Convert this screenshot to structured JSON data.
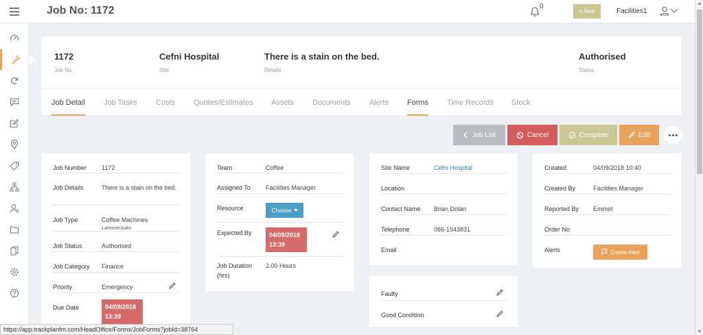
{
  "header": {
    "title": "Job No: 1172",
    "notification_count": "0",
    "new_label": "+ New",
    "user_name": "Facilities1"
  },
  "sidebar": {
    "items": [
      {
        "icon": "speedometer-icon"
      },
      {
        "icon": "wrench-icon",
        "active": true
      },
      {
        "icon": "refresh-icon"
      },
      {
        "icon": "chat-icon"
      },
      {
        "icon": "edit-icon"
      },
      {
        "icon": "location-icon"
      },
      {
        "icon": "tag-icon"
      },
      {
        "icon": "hierarchy-icon"
      },
      {
        "icon": "user-search-icon"
      },
      {
        "icon": "folder-icon"
      },
      {
        "icon": "documents-icon"
      },
      {
        "icon": "gear-icon"
      },
      {
        "icon": "help-icon"
      }
    ]
  },
  "summary": {
    "job_no": {
      "value": "1172",
      "label": "Job No."
    },
    "site": {
      "value": "Cefni Hospital",
      "label": "Site"
    },
    "details": {
      "value": "There is a stain on the bed.",
      "label": "Details"
    },
    "status": {
      "value": "Authorised",
      "label": "Status"
    }
  },
  "tabs": [
    {
      "label": "Job Detail",
      "active": true
    },
    {
      "label": "Job Tasks"
    },
    {
      "label": "Costs"
    },
    {
      "label": "Quotes/Estimates"
    },
    {
      "label": "Assets"
    },
    {
      "label": "Documents"
    },
    {
      "label": "Alerts"
    },
    {
      "label": "Forms",
      "active": true
    },
    {
      "label": "Time Records"
    },
    {
      "label": "Stock"
    }
  ],
  "actions": {
    "job_list": "Job List",
    "cancel": "Cancel",
    "complete": "Complete",
    "edit": "Edit"
  },
  "colors": {
    "accent": "#e7a35c",
    "cancel": "#d45c5c",
    "complete": "#cbc795",
    "job_list": "#b9bcc1",
    "date": "#d46a6a",
    "choose": "#4a9ec8"
  },
  "card1": {
    "job_number": {
      "label": "Job Number",
      "value": "1172"
    },
    "job_details": {
      "label": "Job Details",
      "value": "There is a stain on the bed."
    },
    "job_type": {
      "label": "Job Type",
      "value": "Coffee Machines",
      "sub": "Lammerzuko"
    },
    "job_status": {
      "label": "Job Status",
      "value": "Authorised"
    },
    "job_category": {
      "label": "Job Category",
      "value": "Finance"
    },
    "priority": {
      "label": "Priority",
      "value": "Emergency"
    },
    "due_date": {
      "label": "Due Date",
      "date": "04/09/2018",
      "time": "13:39"
    }
  },
  "card2": {
    "team": {
      "label": "Team",
      "value": "Coffee"
    },
    "assigned_to": {
      "label": "Assigned To",
      "value": "Facilities Manager"
    },
    "resource": {
      "label": "Resource",
      "button": "Choose"
    },
    "expected_by": {
      "label": "Expected By",
      "date": "04/09/2018",
      "time": "13:39"
    },
    "job_duration": {
      "label": "Job Duration (hrs)",
      "value": "2.00 Hours"
    }
  },
  "card3": {
    "site_name": {
      "label": "Site Name",
      "value": "Cefni Hospital"
    },
    "location": {
      "label": "Location",
      "value": ""
    },
    "contact_name": {
      "label": "Contact Name",
      "value": "Brian Dolan"
    },
    "telephone": {
      "label": "Telephone",
      "value": "086-1943831"
    },
    "email": {
      "label": "Email",
      "value": ""
    }
  },
  "card4": {
    "created": {
      "label": "Created",
      "value": "04/09/2018 10:40"
    },
    "created_by": {
      "label": "Created By",
      "value": "Facilities Manager"
    },
    "reported_by": {
      "label": "Reported By",
      "value": "Emmet"
    },
    "order_no": {
      "label": "Order No",
      "value": ""
    },
    "alerts": {
      "label": "Alerts",
      "button": "Create Alert"
    }
  },
  "card5": {
    "faulty": {
      "label": "Faulty"
    },
    "good_condition": {
      "label": "Good Condition"
    }
  },
  "status_bar": {
    "url": "https://app.trackplanfm.com/HeadOffice/Forms/JobForms?jobId=38764"
  }
}
